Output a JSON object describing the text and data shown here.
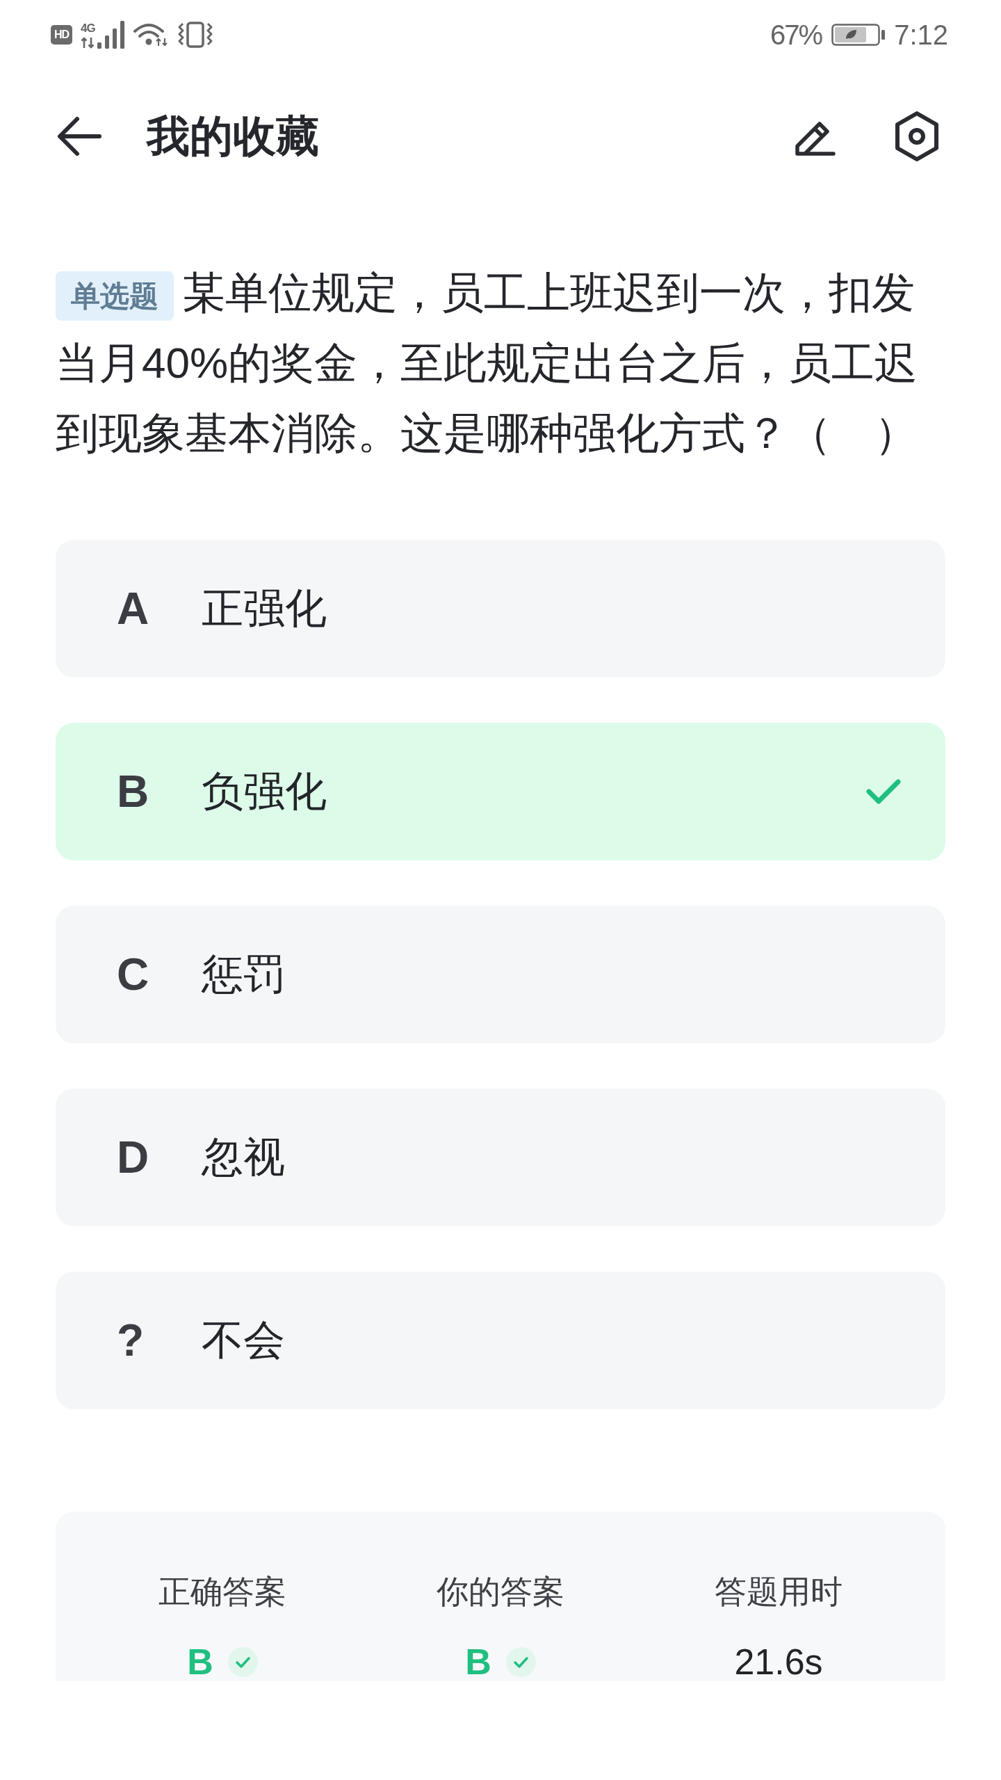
{
  "status_bar": {
    "hd_badge": "HD",
    "network_type": "4G",
    "battery_percent": "67%",
    "time": "7:12"
  },
  "header": {
    "title": "我的收藏"
  },
  "question": {
    "type_tag": "单选题",
    "text": "某单位规定，员工上班迟到一次，扣发当月40%的奖金，至此规定出台之后，员工迟到现象基本消除。这是哪种强化方式？（　）"
  },
  "options": [
    {
      "letter": "A",
      "text": "正强化",
      "selected": false
    },
    {
      "letter": "B",
      "text": "负强化",
      "selected": true
    },
    {
      "letter": "C",
      "text": "惩罚",
      "selected": false
    },
    {
      "letter": "D",
      "text": "忽视",
      "selected": false
    },
    {
      "letter": "?",
      "text": "不会",
      "selected": false
    }
  ],
  "result": {
    "items": [
      {
        "kind": "answer",
        "label": "正确答案",
        "value": "B"
      },
      {
        "kind": "answer",
        "label": "你的答案",
        "value": "B"
      },
      {
        "kind": "time",
        "label": "答题用时",
        "value": "21.6s"
      }
    ]
  }
}
